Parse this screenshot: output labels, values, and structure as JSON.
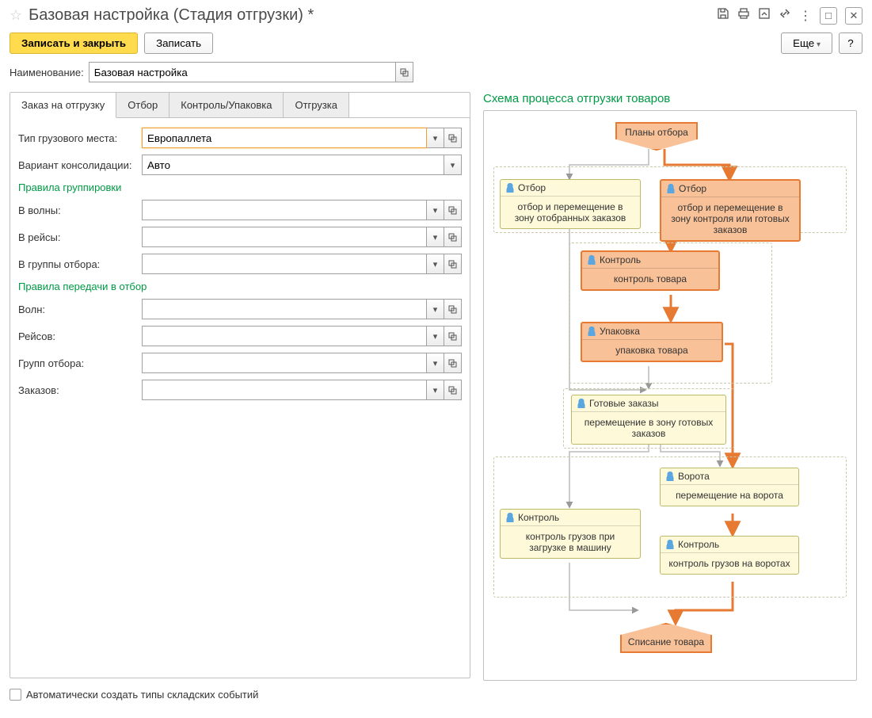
{
  "header": {
    "title": "Базовая настройка (Стадия отгрузки) *"
  },
  "toolbar": {
    "save_close": "Записать и закрыть",
    "save": "Записать",
    "more": "Еще",
    "help": "?"
  },
  "fields": {
    "name_label": "Наименование:",
    "name_value": "Базовая настройка"
  },
  "tabs": {
    "t1": "Заказ на отгрузку",
    "t2": "Отбор",
    "t3": "Контроль/Упаковка",
    "t4": "Отгрузка"
  },
  "form": {
    "cargo_type_label": "Тип грузового места:",
    "cargo_type_value": "Европаллета",
    "consolidation_label": "Вариант консолидации:",
    "consolidation_value": "Авто",
    "group_rules_header": "Правила группировки",
    "in_waves": "В волны:",
    "in_trips": "В рейсы:",
    "in_pick_groups": "В группы отбора:",
    "pass_rules_header": "Правила передачи в отбор",
    "waves": "Волн:",
    "trips": "Рейсов:",
    "pick_groups": "Групп отбора:",
    "orders": "Заказов:"
  },
  "right": {
    "title": "Схема процесса отгрузки товаров"
  },
  "diagram": {
    "start": "Планы отбора",
    "otbor_left_h": "Отбор",
    "otbor_left_b": "отбор и перемещение в зону отобранных заказов",
    "otbor_right_h": "Отбор",
    "otbor_right_b": "отбор и перемещение в зону контроля или готовых заказов",
    "control_h": "Контроль",
    "control_b": "контроль товара",
    "pack_h": "Упаковка",
    "pack_b": "упаковка товара",
    "ready_h": "Готовые заказы",
    "ready_b": "перемещение в зону готовых заказов",
    "gates_h": "Ворота",
    "gates_b": "перемещение на ворота",
    "ctl_load_h": "Контроль",
    "ctl_load_b": "контроль грузов при загрузке в машину",
    "ctl_gate_h": "Контроль",
    "ctl_gate_b": "контроль грузов на воротах",
    "end": "Списание товара"
  },
  "footer": {
    "auto_create": "Автоматически создать типы складских событий"
  }
}
